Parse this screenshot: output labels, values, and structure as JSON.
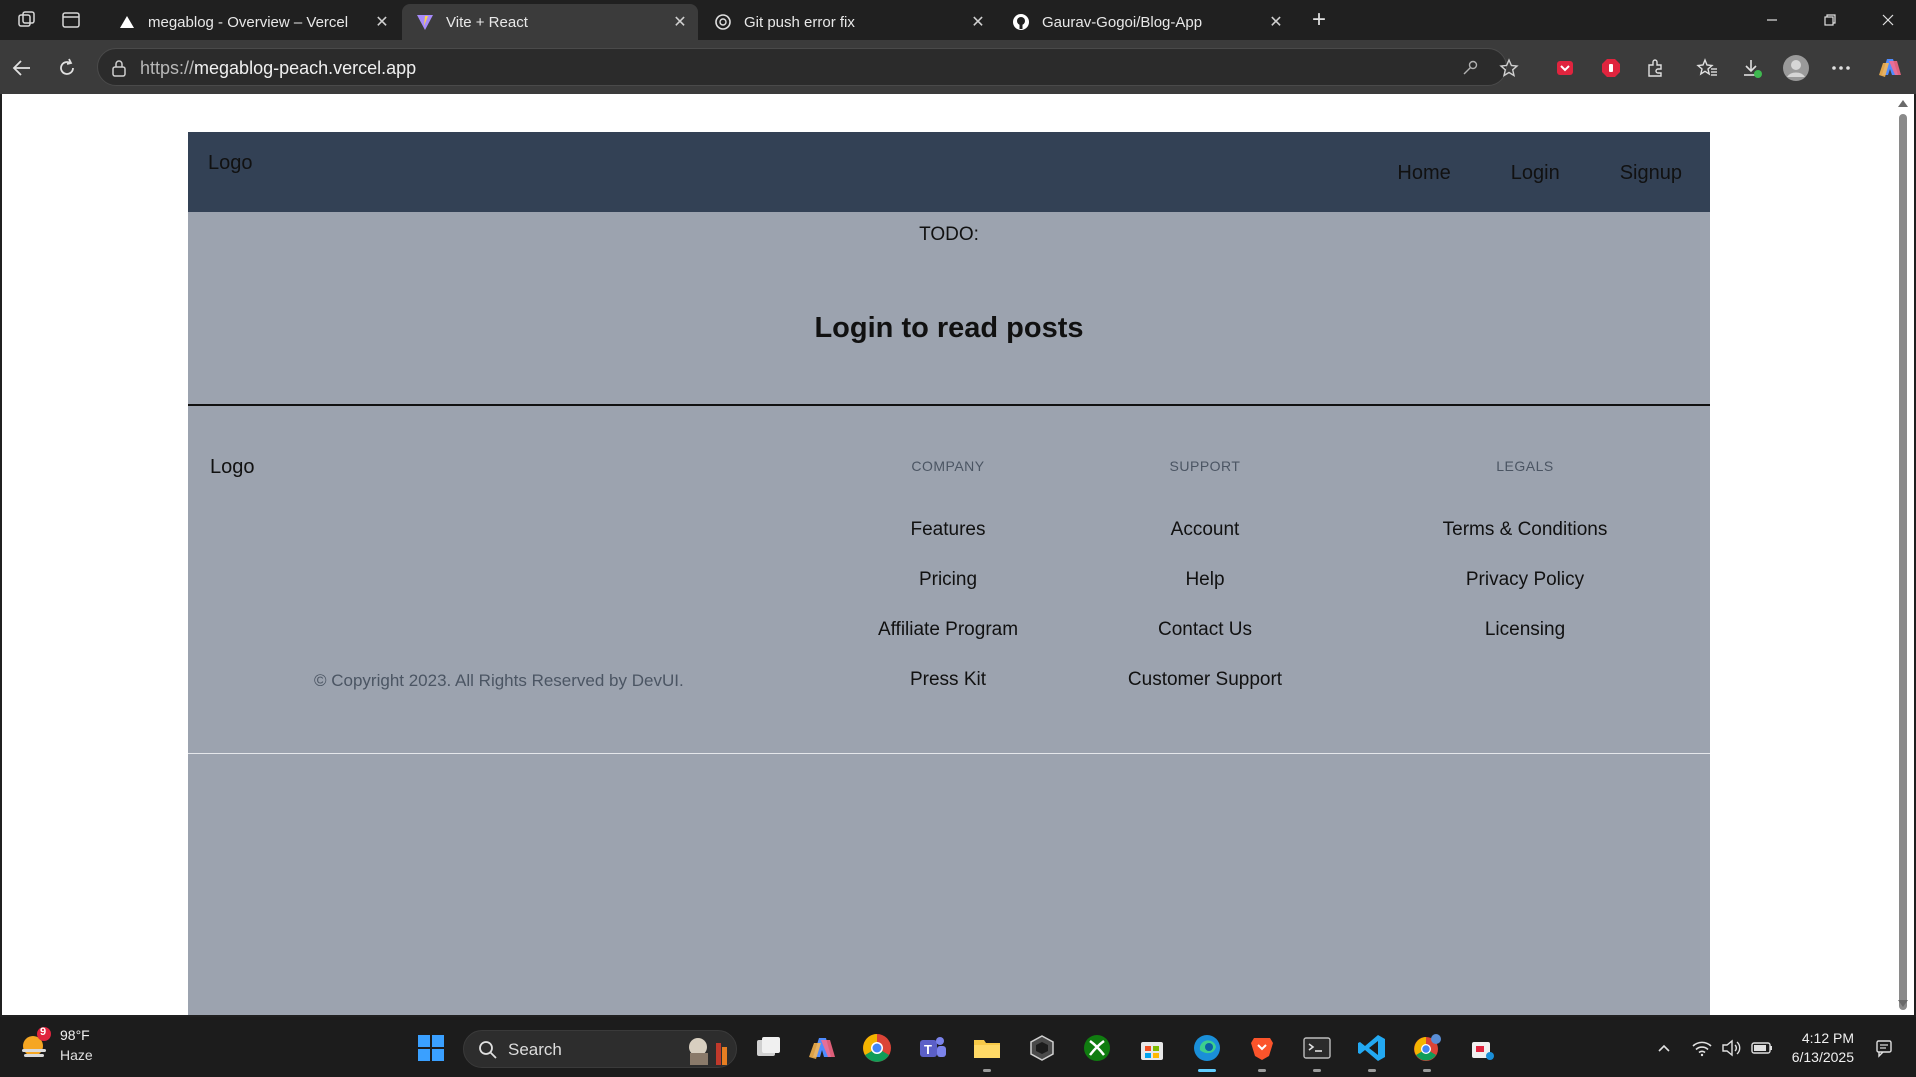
{
  "browser": {
    "tabs": [
      {
        "title": "megablog - Overview – Vercel",
        "icon": "vercel-icon",
        "active": false
      },
      {
        "title": "Vite + React",
        "icon": "vite-icon",
        "active": true
      },
      {
        "title": "Git push error fix",
        "icon": "chatgpt-icon",
        "active": false
      },
      {
        "title": "Gaurav-Gogoi/Blog-App",
        "icon": "github-icon",
        "active": false
      }
    ],
    "address": {
      "protocol": "https://",
      "host": "megablog-peach.vercel.app"
    }
  },
  "site": {
    "header": {
      "logo": "Logo",
      "nav": [
        "Home",
        "Login",
        "Signup"
      ]
    },
    "todo": "TODO:",
    "heading": "Login to read posts",
    "footer": {
      "logo": "Logo",
      "copyright": "© Copyright 2023. All Rights Reserved by DevUI.",
      "columns": [
        {
          "title": "COMPANY",
          "links": [
            "Features",
            "Pricing",
            "Affiliate Program",
            "Press Kit"
          ]
        },
        {
          "title": "SUPPORT",
          "links": [
            "Account",
            "Help",
            "Contact Us",
            "Customer Support"
          ]
        },
        {
          "title": "LEGALS",
          "links": [
            "Terms & Conditions",
            "Privacy Policy",
            "Licensing"
          ]
        }
      ]
    }
  },
  "taskbar": {
    "weather": {
      "badge": "9",
      "temp": "98°F",
      "condition": "Haze"
    },
    "search_label": "Search",
    "clock": {
      "time": "4:12 PM",
      "date": "6/13/2025"
    }
  },
  "colors": {
    "site_bg": "#9ca3af",
    "header_bg": "#334155",
    "browser_dark": "#202020",
    "active_tab": "#3b3b3b"
  }
}
